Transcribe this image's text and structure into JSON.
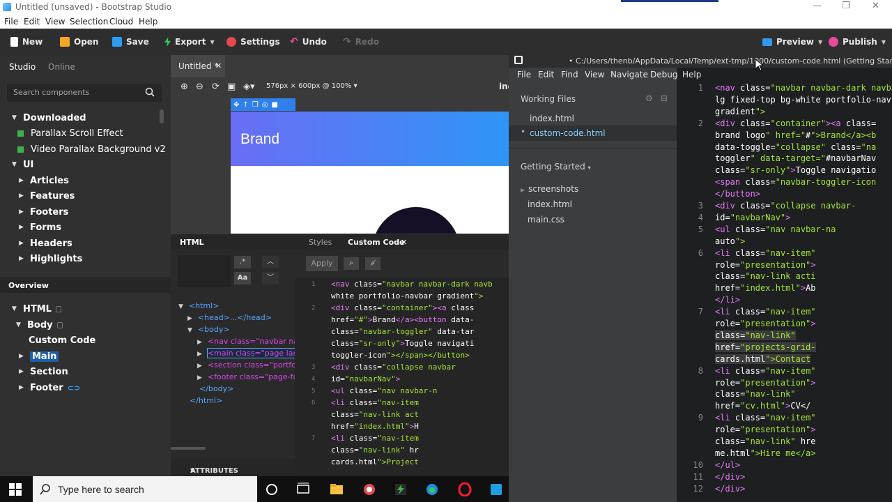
{
  "window": {
    "title": "Untitled (unsaved) - Bootstrap Studio",
    "minimize": "—",
    "maximize": "❐",
    "close": "✕"
  },
  "menubar": [
    "File",
    "Edit",
    "View",
    "Selection",
    "Cloud",
    "Help"
  ],
  "toolbar": {
    "new": "New",
    "open": "Open",
    "save": "Save",
    "export": "Export",
    "settings": "Settings",
    "undo": "Undo",
    "redo": "Redo",
    "preview": "Preview",
    "publish": "Publish"
  },
  "left": {
    "tabs": [
      "Studio",
      "Online"
    ],
    "search_placeholder": "Search components",
    "tree": {
      "downloaded": "Downloaded",
      "items_downloaded": [
        "Parallax Scroll Effect",
        "Video Parallax Background v2"
      ],
      "ui": "UI",
      "items_ui": [
        "Articles",
        "Features",
        "Footers",
        "Forms",
        "Headers",
        "Highlights"
      ]
    },
    "overview": {
      "title": "Overview",
      "html": "HTML",
      "body": "Body",
      "custom_code": "Custom Code",
      "main": "Main",
      "section": "Section",
      "footer": "Footer"
    }
  },
  "center": {
    "tab": "Untitled *",
    "size_label": "576px × 600px @ 100%",
    "inc": "inc",
    "brand": "Brand"
  },
  "bottom": {
    "tabs": [
      "HTML",
      "Styles",
      "Custom Code"
    ],
    "find_regex": ".*",
    "find_case": "Aa",
    "apply": "Apply",
    "dom": [
      "<html>",
      "<head>...</head>",
      "<body>",
      "<nav class=\"navbar na",
      "<main class=\"page lani",
      "<section class=\"portfoli",
      "<footer class=\"page-fo",
      "</body>",
      "</html>"
    ],
    "attributes": "ATTRIBUTES",
    "code": [
      {
        "n": "1",
        "t": "<nav class=\"navbar navbar-dark navb"
      },
      {
        "n": "",
        "t": "white portfolio-navbar gradient\">"
      },
      {
        "n": "2",
        "t": "    <div class=\"container\"><a class"
      },
      {
        "n": "",
        "t": "    href=\"#\">Brand</a><button data-"
      },
      {
        "n": "",
        "t": "    class=\"navbar-toggler\" data-tar"
      },
      {
        "n": "",
        "t": "    class=\"sr-only\">Toggle navigati"
      },
      {
        "n": "",
        "t": "    toggler-icon\"></span></button>"
      },
      {
        "n": "3",
        "t": "        <div class=\"collapse navbar"
      },
      {
        "n": "4",
        "t": "            id=\"navbarNav\">"
      },
      {
        "n": "5",
        "t": "            <ul class=\"nav navbar-n"
      },
      {
        "n": "6",
        "t": "                <li class=\"nav-item"
      },
      {
        "n": "",
        "t": "                class=\"nav-link act"
      },
      {
        "n": "",
        "t": "                href=\"index.html\">H"
      },
      {
        "n": "7",
        "t": "                <li class=\"nav-item"
      },
      {
        "n": "",
        "t": "                class=\"nav-link\" hr"
      },
      {
        "n": "",
        "t": "                cards.html\">Project"
      }
    ]
  },
  "editor": {
    "title": "• C:/Users/thenb/AppData/Local/Temp/ext-tmp/1000/custom-code.html (Getting Started) - B",
    "menu": [
      "File",
      "Edit",
      "Find",
      "View",
      "Navigate",
      "Debug",
      "Help"
    ],
    "working_files": "Working Files",
    "files": [
      "index.html",
      "custom-code.html"
    ],
    "project": "Getting Started",
    "project_items": [
      "screenshots",
      "index.html",
      "main.css"
    ],
    "code": [
      {
        "n": "1",
        "t": "<nav class=\"navbar navbar-dark navba"
      },
      {
        "n": "",
        "t": "lg fixed-top bg-white portfolio-navb"
      },
      {
        "n": "",
        "t": "gradient\">"
      },
      {
        "n": "2",
        "t": "    <div class=\"container\"><a class="
      },
      {
        "n": "",
        "t": "    brand logo\" href=\"#\">Brand</a><b"
      },
      {
        "n": "",
        "t": "    data-toggle=\"collapse\" class=\"na"
      },
      {
        "n": "",
        "t": "    toggler\" data-target=\"#navbarNav"
      },
      {
        "n": "",
        "t": "    class=\"sr-only\">Toggle navigatio"
      },
      {
        "n": "",
        "t": "    <span class=\"navbar-toggler-icon"
      },
      {
        "n": "",
        "t": "    </button>"
      },
      {
        "n": "3",
        "t": "        <div class=\"collapse navbar-"
      },
      {
        "n": "4",
        "t": "            id=\"navbarNav\">"
      },
      {
        "n": "5",
        "t": "            <ul class=\"nav navbar-na"
      },
      {
        "n": "",
        "t": "            auto\">"
      },
      {
        "n": "6",
        "t": "                <li class=\"nav-item\""
      },
      {
        "n": "",
        "t": "                role=\"presentation\">"
      },
      {
        "n": "",
        "t": "                class=\"nav-link acti"
      },
      {
        "n": "",
        "t": "                href=\"index.html\">Ab"
      },
      {
        "n": "",
        "t": "                </li>"
      },
      {
        "n": "7",
        "t": "                <li class=\"nav-item\""
      },
      {
        "n": "",
        "t": "                role=\"presentation\">"
      },
      {
        "n": "",
        "t": "                class=\"nav-link\""
      },
      {
        "n": "",
        "t": "                href=\"projects-grid-"
      },
      {
        "n": "",
        "t": "                cards.html\">Contact"
      },
      {
        "n": "8",
        "t": "                <li class=\"nav-item\""
      },
      {
        "n": "",
        "t": "                role=\"presentation\">"
      },
      {
        "n": "",
        "t": "                class=\"nav-link\""
      },
      {
        "n": "",
        "t": "                href=\"cv.html\">CV</"
      },
      {
        "n": "9",
        "t": "                <li class=\"nav-item\""
      },
      {
        "n": "",
        "t": "                role=\"presentation\">"
      },
      {
        "n": "",
        "t": "                class=\"nav-link\" hre"
      },
      {
        "n": "",
        "t": "                me.html\">Hire me</a>"
      },
      {
        "n": "10",
        "t": "            </ul>"
      },
      {
        "n": "11",
        "t": "        </div>"
      },
      {
        "n": "12",
        "t": "    </div>"
      }
    ]
  },
  "taskbar": {
    "search_placeholder": "Type here to search"
  },
  "colors": {
    "accent": "#2f80ed",
    "tag": "#e879f9",
    "string": "#a3e635",
    "downloaded_square": "#3cb34a"
  }
}
